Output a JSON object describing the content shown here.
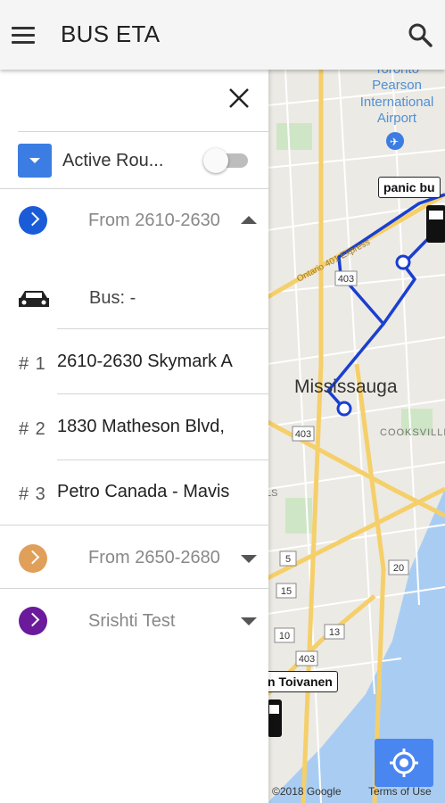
{
  "app": {
    "title": "BUS ETA"
  },
  "drawer": {
    "active_routes_label": "Active Rou...",
    "routes": [
      {
        "name": "From 2610-2630",
        "color": "#1a5cd8",
        "expanded": true,
        "bus_label": "Bus: -",
        "stops": [
          {
            "num": "# 1",
            "name": "2610-2630 Skymark A"
          },
          {
            "num": "# 2",
            "name": "1830 Matheson Blvd,"
          },
          {
            "num": "# 3",
            "name": "Petro Canada - Mavis"
          }
        ]
      },
      {
        "name": "From 2650-2680",
        "color": "#e0a05a",
        "expanded": false
      },
      {
        "name": "Srishti Test",
        "color": "#6a1a9a",
        "expanded": false
      }
    ]
  },
  "map": {
    "bus_labels": [
      "panic bu",
      "n Toivanen"
    ],
    "place_labels": {
      "airport": [
        "Toronto",
        "Pearson",
        "International",
        "Airport"
      ],
      "city": "Mississauga",
      "district": "COOKSVILLE",
      "highway": "Ontario 401 Express",
      "shields": [
        "403",
        "403",
        "5",
        "10",
        "13",
        "15",
        "20",
        "403"
      ],
      "partial": "LS"
    },
    "footer_left": "©2018 Google",
    "footer_right": "Terms of Use",
    "route_color": "#1a3fd0"
  }
}
